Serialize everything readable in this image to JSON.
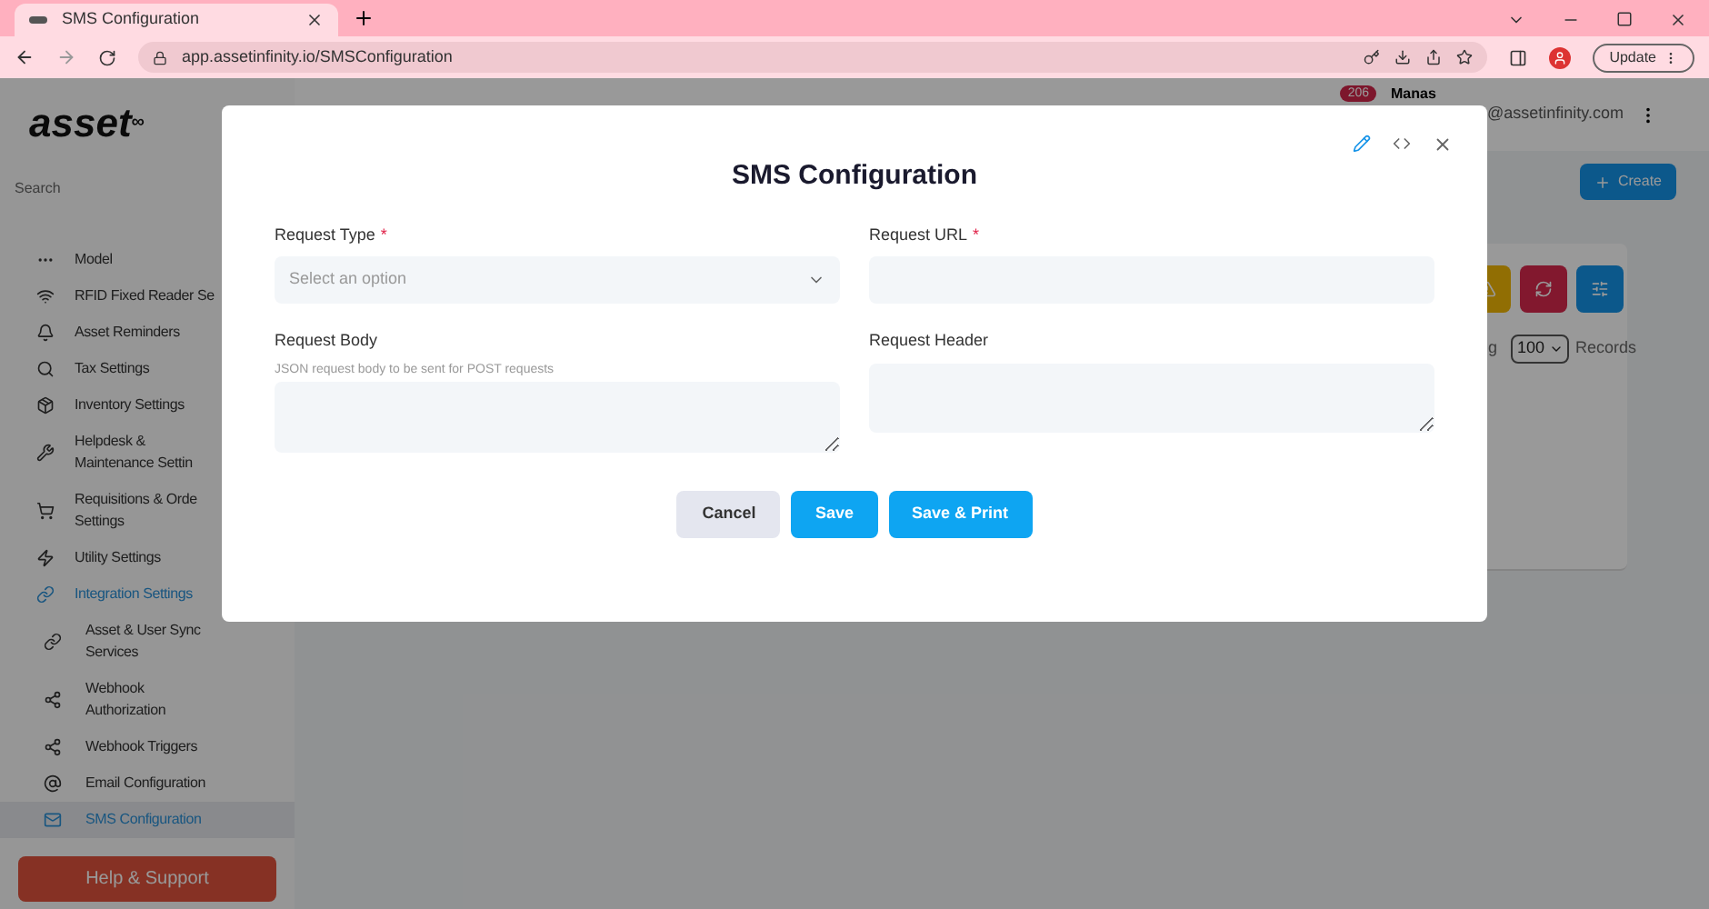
{
  "browser": {
    "tab_title": "SMS Configuration",
    "url": "app.assetinfinity.io/SMSConfiguration",
    "update_button": "Update"
  },
  "header": {
    "logo": "asset",
    "logo_mark": "∞",
    "notification_count": "206",
    "user_name": "Manas",
    "user_email": "@assetinfinity.com"
  },
  "sidebar": {
    "search_placeholder": "Search",
    "items": [
      {
        "label": "Model",
        "expanded": false,
        "selected": false
      },
      {
        "label": "RFID Fixed Reader Se",
        "expanded": false,
        "selected": false
      },
      {
        "label": "Asset Reminders",
        "expanded": false,
        "selected": false
      },
      {
        "label": "Tax Settings",
        "expanded": false,
        "selected": false
      },
      {
        "label": "Inventory Settings",
        "expanded": false,
        "selected": false
      },
      {
        "label": "Helpdesk & Maintenance Settin",
        "expanded": false,
        "selected": false
      },
      {
        "label": "Requisitions & Orde Settings",
        "expanded": false,
        "selected": false
      },
      {
        "label": "Utility Settings",
        "expanded": false,
        "selected": false
      },
      {
        "label": "Integration Settings",
        "expanded": true,
        "selected": false,
        "children": [
          {
            "label": "Asset & User Sync Services",
            "selected": false
          },
          {
            "label": "Webhook Authorization",
            "selected": false
          },
          {
            "label": "Webhook Triggers",
            "selected": false
          },
          {
            "label": "Email Configuration",
            "selected": false
          },
          {
            "label": "SMS Configuration",
            "selected": true
          }
        ]
      }
    ],
    "help_button": "Help & Support"
  },
  "main": {
    "create_button": "Create",
    "page_size_prefix": "g",
    "page_size": "100",
    "page_size_suffix": "Records"
  },
  "modal": {
    "title": "SMS Configuration",
    "fields": [
      {
        "label": "Request Type",
        "required_mark": "*",
        "kind": "select",
        "placeholder": "Select an option"
      },
      {
        "label": "Request URL",
        "required_mark": "*",
        "kind": "input"
      },
      {
        "label": "Request Body",
        "kind": "textarea",
        "hint": "JSON request body to be sent for POST requests"
      },
      {
        "label": "Request Header",
        "kind": "textarea"
      }
    ],
    "buttons": [
      {
        "label": "Cancel",
        "kind": "secondary"
      },
      {
        "label": "Save",
        "kind": "primary"
      },
      {
        "label": "Save & Print",
        "kind": "primary"
      }
    ]
  }
}
